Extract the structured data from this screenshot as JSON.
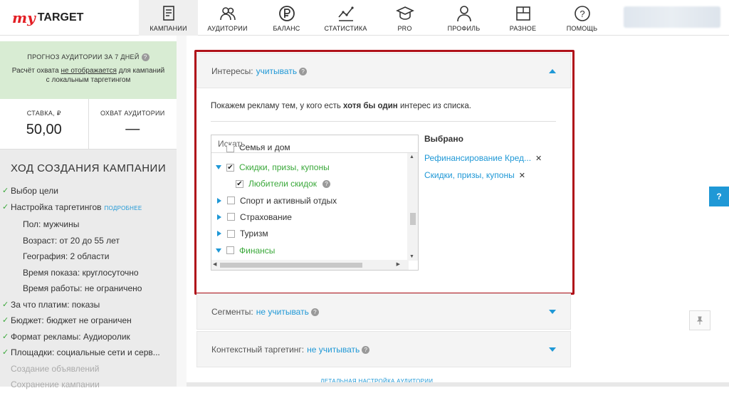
{
  "logo": {
    "prefix": "my",
    "name": "TARGET"
  },
  "nav": [
    {
      "label": "КАМПАНИИ",
      "icon": "campaigns-icon",
      "active": true
    },
    {
      "label": "АУДИТОРИИ",
      "icon": "audiences-icon",
      "active": false
    },
    {
      "label": "БАЛАНС",
      "icon": "ruble-icon",
      "active": false
    },
    {
      "label": "СТАТИСТИКА",
      "icon": "chart-icon",
      "active": false
    },
    {
      "label": "PRO",
      "icon": "graduation-cap-icon",
      "active": false
    },
    {
      "label": "ПРОФИЛЬ",
      "icon": "user-icon",
      "active": false
    },
    {
      "label": "РАЗНОЕ",
      "icon": "window-icon",
      "active": false
    },
    {
      "label": "ПОМОЩЬ",
      "icon": "help-icon",
      "active": false
    }
  ],
  "sidebar": {
    "forecast_title": "ПРОГНОЗ АУДИТОРИИ ЗА 7 ДНЕЙ",
    "forecast_text_1": "Расчёт охвата",
    "forecast_text_link": "не отображается",
    "forecast_text_2": "для кампаний",
    "forecast_text_3": "с локальным таргетингом",
    "bid_label": "СТАВКА, ₽",
    "bid_value": "50,00",
    "reach_label": "ОХВАТ АУДИТОРИИ",
    "reach_value": "—",
    "steps_title": "ХОД СОЗДАНИЯ КАМПАНИИ",
    "more_link": "ПОДРОБНЕЕ",
    "steps": [
      {
        "text": "Выбор цели",
        "state": "done"
      },
      {
        "text": "Настройка таргетингов",
        "state": "done"
      },
      {
        "text": "Пол: мужчины",
        "state": "sub"
      },
      {
        "text": "Возраст: от 20 до 55 лет",
        "state": "sub"
      },
      {
        "text": "География: 2 области",
        "state": "sub"
      },
      {
        "text": "Время показа: круглосуточно",
        "state": "sub"
      },
      {
        "text": "Время работы: не ограничено",
        "state": "sub"
      },
      {
        "text": "За что платим: показы",
        "state": "done"
      },
      {
        "text": "Бюджет: бюджет не ограничен",
        "state": "done"
      },
      {
        "text": "Формат рекламы: Аудиоролик",
        "state": "done"
      },
      {
        "text": "Площадки: социальные сети и серв...",
        "state": "done"
      },
      {
        "text": "Создание объявлений",
        "state": "muted"
      },
      {
        "text": "Сохранение кампании",
        "state": "muted"
      }
    ]
  },
  "interests": {
    "label": "Интересы:",
    "value": "учитывать",
    "hint_1": "Покажем рекламу тем, у кого есть",
    "hint_bold": "хотя бы один",
    "hint_2": "интерес из списка.",
    "search_placeholder": "Искать...",
    "tree": [
      {
        "text": "Семья и дом",
        "checked": false,
        "caret": "none",
        "indent": 0,
        "green": false
      },
      {
        "text": "Скидки, призы, купоны",
        "checked": true,
        "caret": "down",
        "indent": 0,
        "green": true
      },
      {
        "text": "Любители скидок",
        "checked": true,
        "caret": "none",
        "indent": 1,
        "green": true
      },
      {
        "text": "Спорт и активный отдых",
        "checked": false,
        "caret": "right",
        "indent": 0,
        "green": false
      },
      {
        "text": "Страхование",
        "checked": false,
        "caret": "right",
        "indent": 0,
        "green": false
      },
      {
        "text": "Туризм",
        "checked": false,
        "caret": "right",
        "indent": 0,
        "green": false
      },
      {
        "text": "Финансы",
        "checked": false,
        "caret": "down",
        "indent": 0,
        "green": true
      }
    ],
    "selected_title": "Выбрано",
    "selected": [
      "Рефинансирование Кред...",
      "Скидки, призы, купоны"
    ]
  },
  "segments": {
    "label": "Сегменты:",
    "value": "не учитывать"
  },
  "context": {
    "label": "Контекстный таргетинг:",
    "value": "не учитывать"
  },
  "help_button": "?",
  "bottom_link": "ДЕТАЛЬНАЯ НАСТРОЙКА АУДИТОРИИ",
  "colors": {
    "accent": "#1f98d6",
    "green": "#3aa83a",
    "highlight": "#b0121a",
    "forecast_bg": "#d8ecd3"
  }
}
